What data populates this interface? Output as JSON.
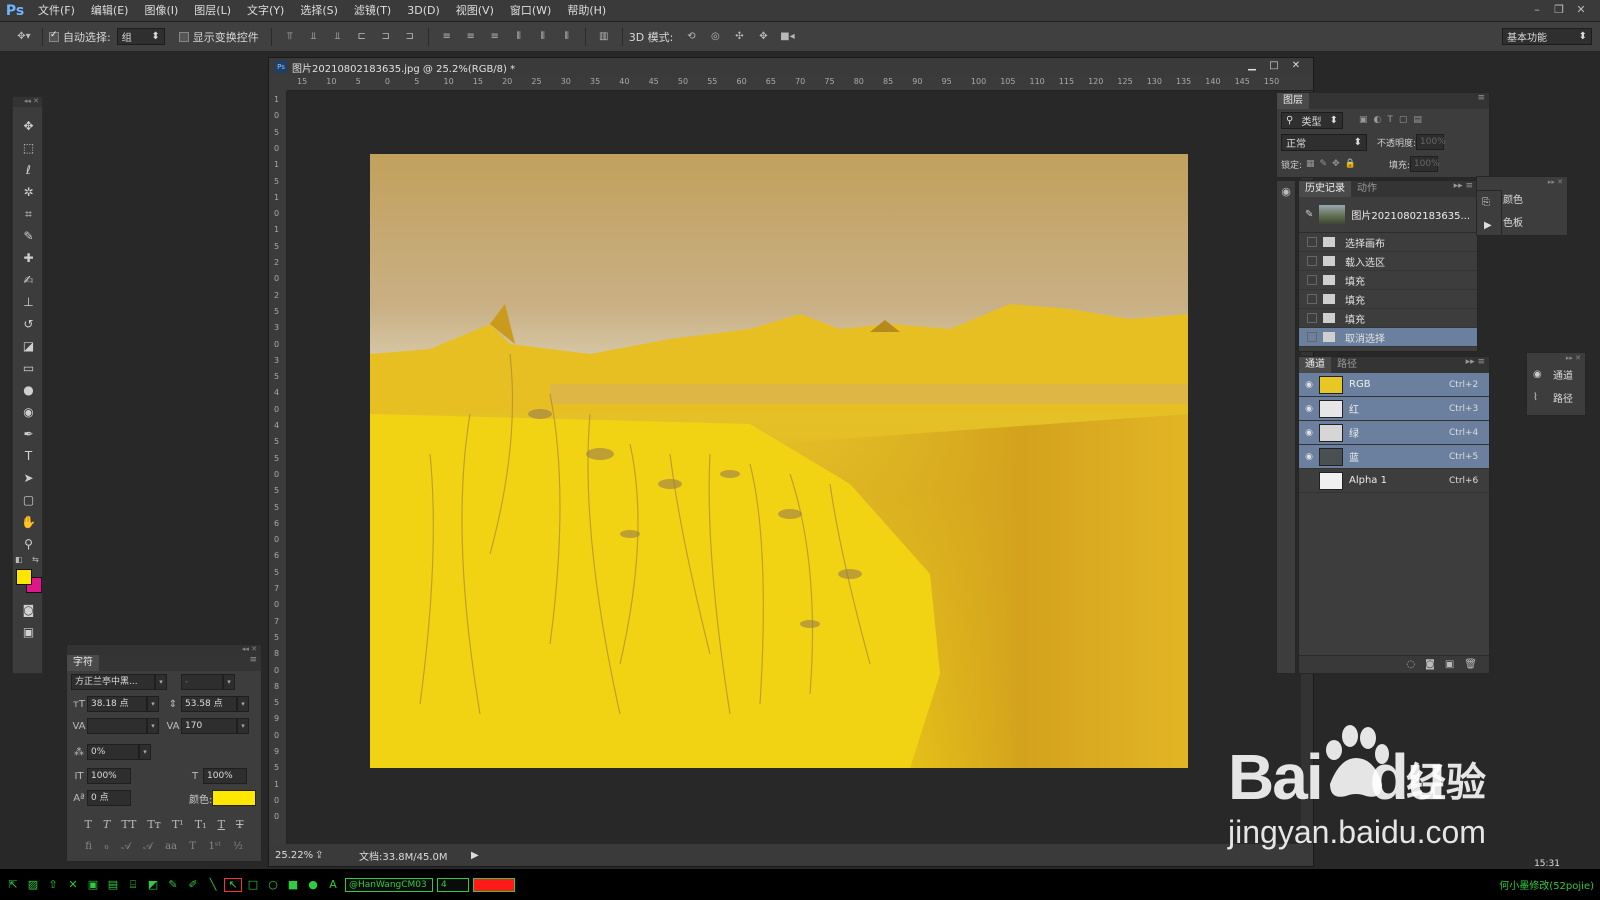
{
  "app": {
    "logo": "Ps",
    "menu": [
      "文件(F)",
      "编辑(E)",
      "图像(I)",
      "图层(L)",
      "文字(Y)",
      "选择(S)",
      "滤镜(T)",
      "3D(D)",
      "视图(V)",
      "窗口(W)",
      "帮助(H)"
    ]
  },
  "options": {
    "auto_select_label": "自动选择:",
    "auto_select_value": "组",
    "show_transform_label": "显示变换控件",
    "mode_3d_label": "3D 模式:",
    "workspace": "基本功能"
  },
  "document": {
    "title": "图片20210802183635.jpg @ 25.2%(RGB/8) *",
    "zoom": "25.22%",
    "doc_info": "文档:33.8M/45.0M",
    "ruler_h": [
      "15",
      "10",
      "5",
      "0",
      "5",
      "10",
      "15",
      "20",
      "25",
      "30",
      "35",
      "40",
      "45",
      "50",
      "55",
      "60",
      "65",
      "70",
      "75",
      "80",
      "85",
      "90",
      "95",
      "100",
      "105",
      "110",
      "115",
      "120",
      "125",
      "130",
      "135",
      "140",
      "145",
      "150"
    ],
    "ruler_v": [
      "1",
      "0",
      "5",
      "0",
      "1",
      "5",
      "1",
      "0",
      "1",
      "5",
      "2",
      "0",
      "2",
      "5",
      "3",
      "0",
      "3",
      "5",
      "4",
      "0",
      "4",
      "5",
      "5",
      "0",
      "5",
      "5",
      "6",
      "0",
      "6",
      "5",
      "7",
      "0",
      "7",
      "5",
      "8",
      "0",
      "8",
      "5",
      "9",
      "0",
      "9",
      "5",
      "1",
      "0",
      "0"
    ]
  },
  "character_panel": {
    "tab": "字符",
    "font_family": "方正兰亭中黑...",
    "font_style": "-",
    "font_size": "38.18 点",
    "leading": "53.58 点",
    "kerning": "",
    "tracking": "170",
    "tsume": "0%",
    "vscale": "100%",
    "hscale": "100%",
    "baseline": "0 点",
    "color_label": "颜色:",
    "text_color": "#ffe800"
  },
  "layers_panel": {
    "tab": "图层",
    "filter": "类型",
    "blend": "正常",
    "opacity_label": "不透明度:",
    "opacity": "100%",
    "lock_label": "锁定:",
    "fill_label": "填充:",
    "fill": "100%"
  },
  "history_panel": {
    "tabs": [
      "历史记录",
      "动作"
    ],
    "snapshot": "图片20210802183635...",
    "items": [
      {
        "label": "选择画布",
        "selected": false
      },
      {
        "label": "载入选区",
        "selected": false
      },
      {
        "label": "填充",
        "selected": false
      },
      {
        "label": "填充",
        "selected": false
      },
      {
        "label": "填充",
        "selected": false
      },
      {
        "label": "取消选择",
        "selected": true
      }
    ]
  },
  "channels_panel": {
    "tabs": [
      "通道",
      "路径"
    ],
    "channels": [
      {
        "name": "RGB",
        "key": "Ctrl+2",
        "visible": true,
        "selected": true,
        "thumb": "#e8c623"
      },
      {
        "name": "红",
        "key": "Ctrl+3",
        "visible": true,
        "selected": true,
        "thumb": "#e6e6e6"
      },
      {
        "name": "绿",
        "key": "Ctrl+4",
        "visible": true,
        "selected": true,
        "thumb": "#d6d6d6"
      },
      {
        "name": "蓝",
        "key": "Ctrl+5",
        "visible": true,
        "selected": true,
        "thumb": "#4a4f52"
      },
      {
        "name": "Alpha 1",
        "key": "Ctrl+6",
        "visible": false,
        "selected": false,
        "thumb": "#f0f0f0"
      }
    ]
  },
  "mini_panels": {
    "color": "颜色",
    "swatches": "色板",
    "channels": "通道",
    "paths": "路径"
  },
  "colors": {
    "foreground": "#ffe600",
    "background": "#e0158a",
    "selection": "#6b7f9e",
    "taskbar_green": "#2ecc40",
    "taskbar_swatch": "#ff1a1a"
  },
  "taskbar": {
    "user": "@HanWangCM03",
    "size": "4",
    "time": "15:31",
    "right_text": "何小墨修改(52pojie)"
  },
  "watermark": {
    "brand": "Bai",
    "brand_du": "du",
    "brand_cn": "经验",
    "url": "jingyan.baidu.com"
  }
}
